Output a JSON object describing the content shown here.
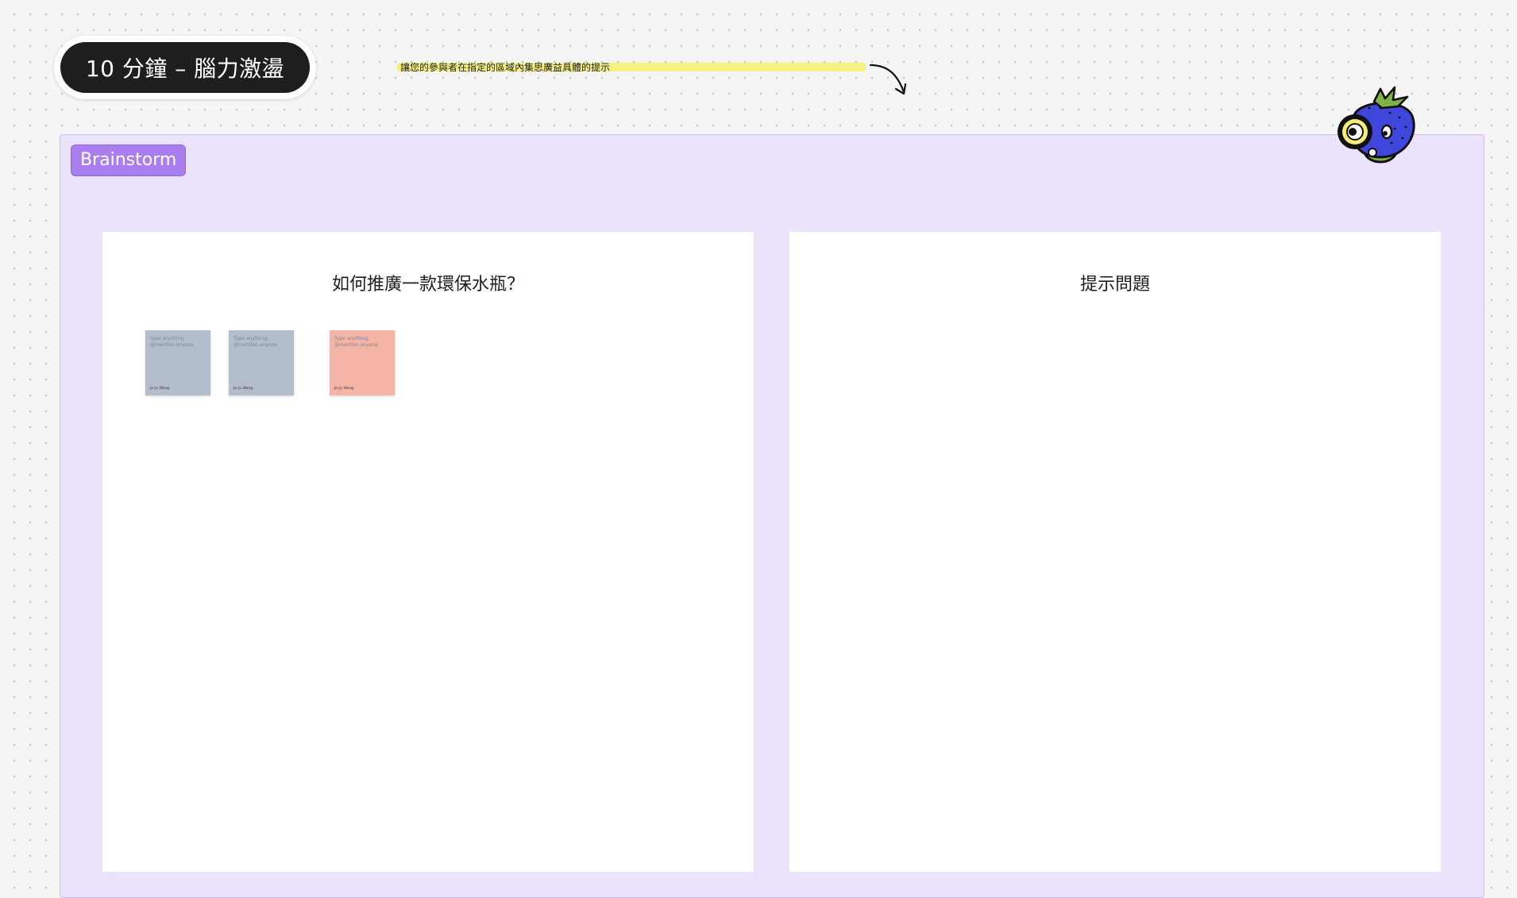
{
  "title": "10 分鐘 – 腦力激盪",
  "hint": {
    "text": "讓您的參與者在指定的區域內集思廣益具體的提示",
    "highlight_color": "#f6ee74"
  },
  "section": {
    "label": "Brainstorm",
    "background_color": "#ebe3fc",
    "label_color": "#a97ff0"
  },
  "cards": [
    {
      "title": "如何推廣一款環保水瓶？",
      "stickies": [
        {
          "placeholder": "Type anything, @mention anyone",
          "author": "Jo-Ju Wang",
          "color": "#b4bdcc"
        },
        {
          "placeholder": "Type anything, @mention anyone",
          "author": "Jo-Ju Wang",
          "color": "#b4bdcc"
        },
        {
          "placeholder": "Type anything, @mention anyone",
          "author": "Jo-Ju Wang",
          "color": "#f4b4a6"
        }
      ]
    },
    {
      "title": "提示問題",
      "stickies": []
    }
  ],
  "icons": {
    "hint_arrow": "curved-arrow-icon",
    "mascot": "strawberry-magnifier-mascot-icon"
  }
}
